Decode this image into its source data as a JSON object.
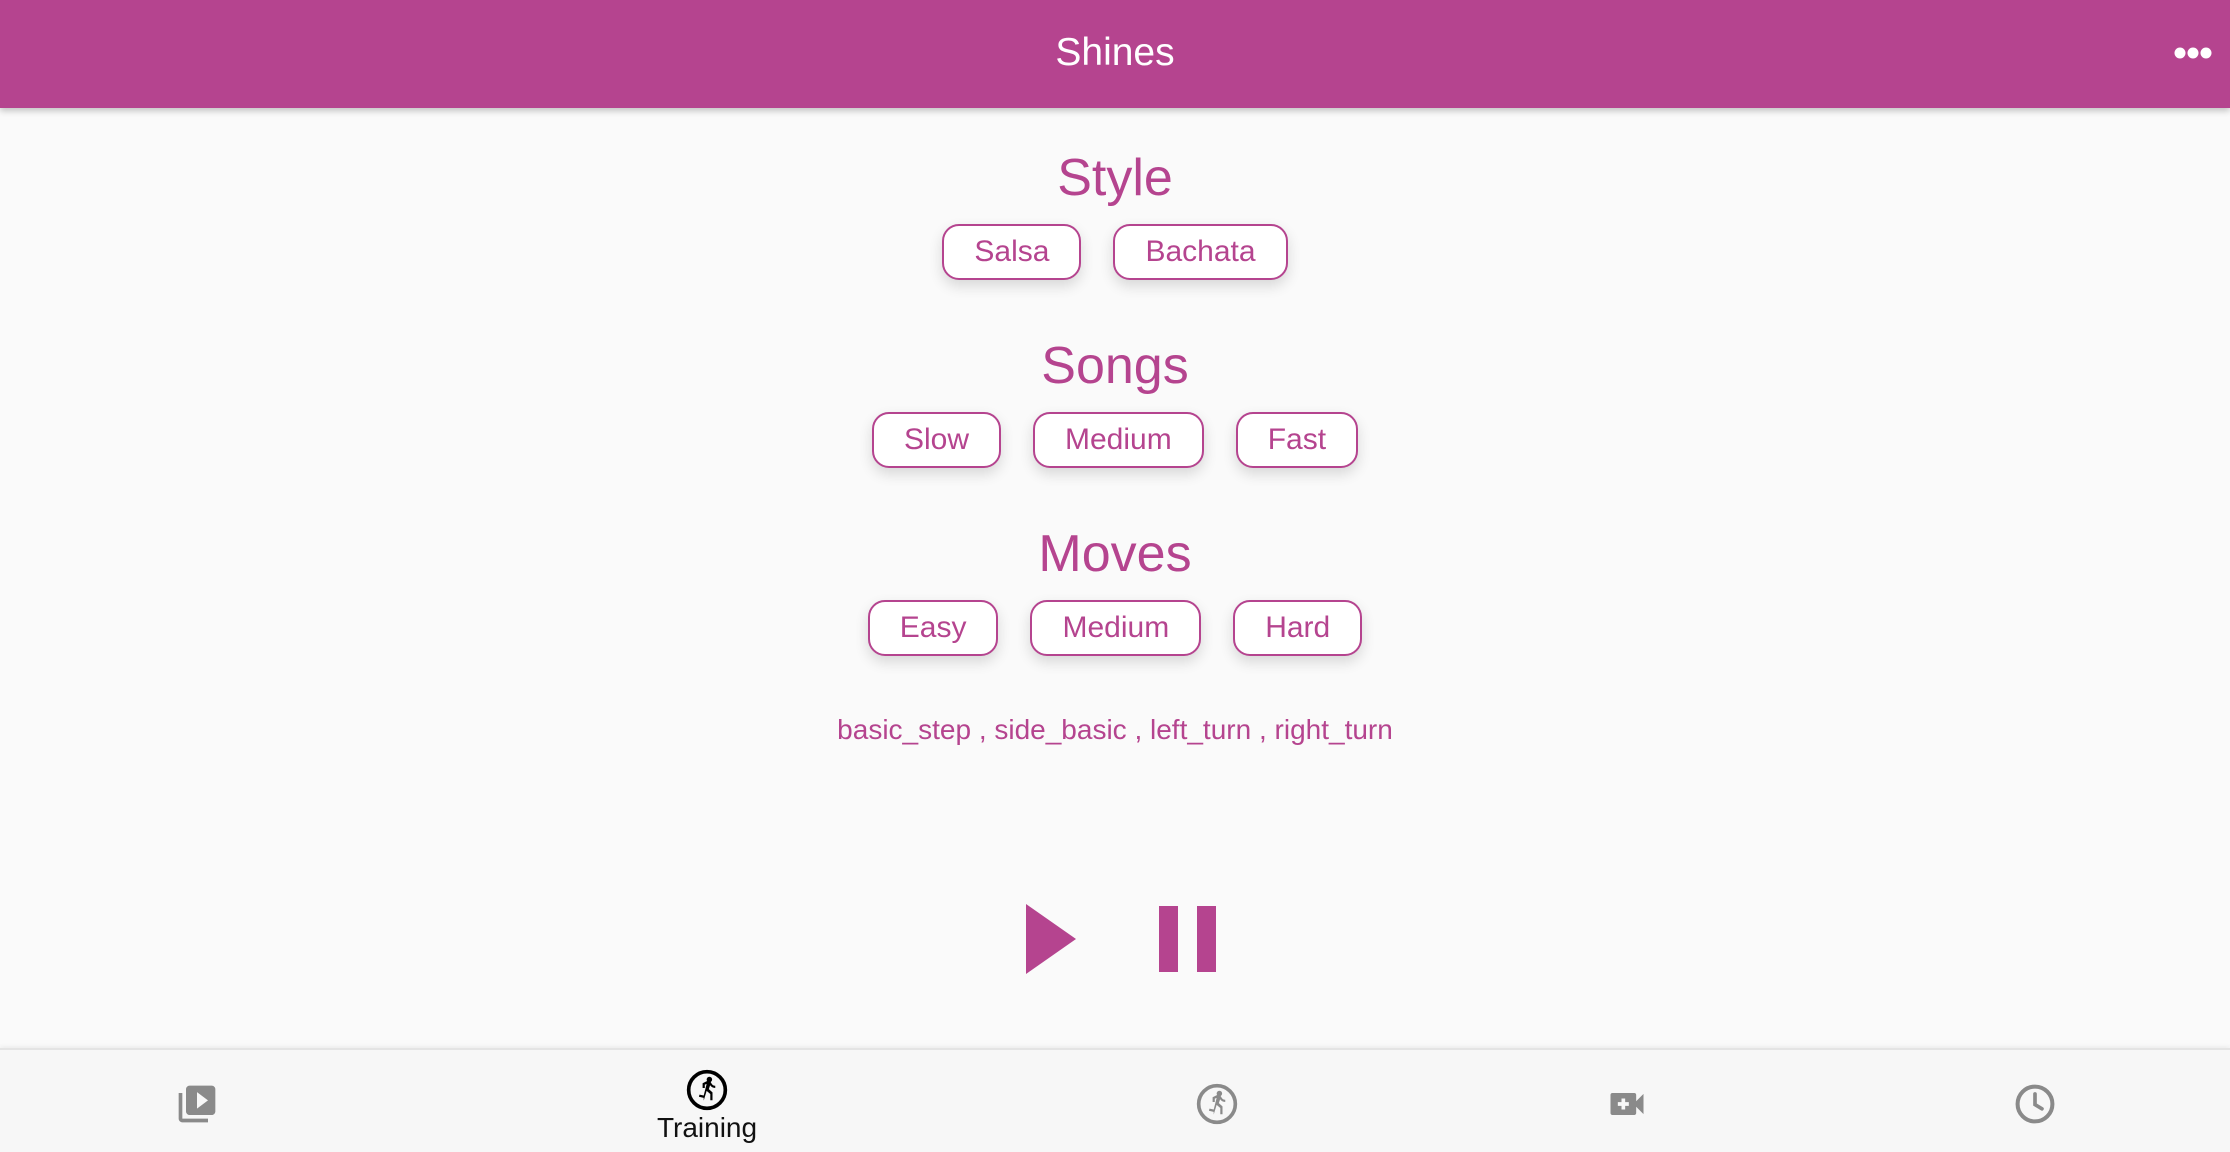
{
  "app": {
    "title": "Shines"
  },
  "colors": {
    "primary": "#b5448f",
    "background": "#fafafa",
    "nav_inactive": "#8a8a8a",
    "nav_active": "#000000"
  },
  "sections": {
    "style": {
      "title": "Style",
      "options": [
        "Salsa",
        "Bachata"
      ]
    },
    "songs": {
      "title": "Songs",
      "options": [
        "Slow",
        "Medium",
        "Fast"
      ]
    },
    "moves": {
      "title": "Moves",
      "options": [
        "Easy",
        "Medium",
        "Hard"
      ]
    }
  },
  "moves_list": "basic_step , side_basic , left_turn , right_turn",
  "player": {
    "play_icon": "play-icon",
    "pause_icon": "pause-icon"
  },
  "bottom_nav": {
    "items": [
      {
        "icon": "video-library-icon",
        "label": "",
        "active": false
      },
      {
        "icon": "run-circle-icon",
        "label": "Training",
        "active": true
      },
      {
        "icon": "run-circle-icon",
        "label": "",
        "active": false
      },
      {
        "icon": "video-add-icon",
        "label": "",
        "active": false
      },
      {
        "icon": "clock-icon",
        "label": "",
        "active": false
      }
    ]
  }
}
